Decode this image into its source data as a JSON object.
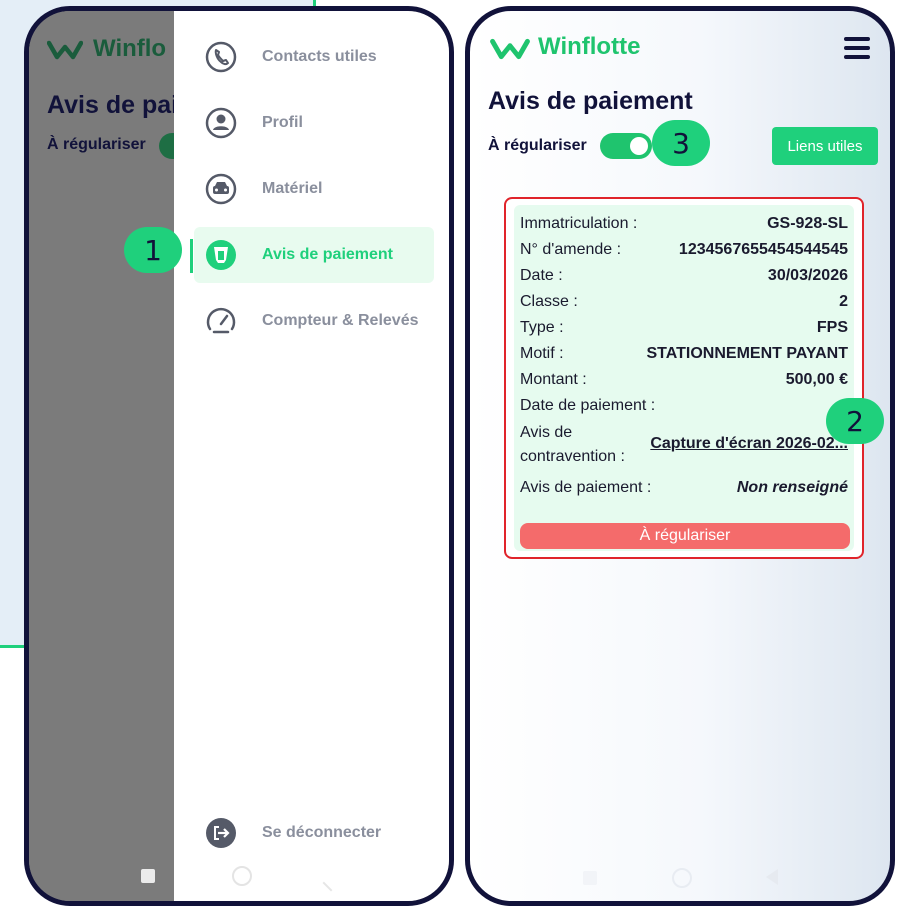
{
  "colors": {
    "brand_green": "#1fd07c",
    "dark_navy": "#11123a",
    "alert_red": "#e0242b",
    "status_button": "#f46b6b",
    "card_bg": "#e6fbef",
    "menu_gray": "#8a8f9d"
  },
  "brand": {
    "name": "Winflotte",
    "name_cropped": "Winflo"
  },
  "page": {
    "title": "Avis de paiement",
    "title_cropped": "Avis de pai",
    "toggle_label": "À régulariser",
    "toggle_on": true,
    "links_button": "Liens utiles"
  },
  "drawer": {
    "items": [
      {
        "label": "Contacts utiles",
        "icon": "phone-icon"
      },
      {
        "label": "Profil",
        "icon": "user-icon"
      },
      {
        "label": "Matériel",
        "icon": "car-icon"
      },
      {
        "label": "Avis de paiement",
        "icon": "cup-icon",
        "active": true
      },
      {
        "label": "Compteur & Relevés",
        "icon": "speedometer-icon"
      }
    ],
    "logout": {
      "label": "Se déconnecter",
      "icon": "logout-icon"
    }
  },
  "card": {
    "fields": [
      {
        "label": "Immatriculation :",
        "value": "GS-928-SL"
      },
      {
        "label": "N° d'amende :",
        "value": "1234567655454544545"
      },
      {
        "label": "Date :",
        "value": "30/03/2026"
      },
      {
        "label": "Classe :",
        "value": "2"
      },
      {
        "label": "Type :",
        "value": "FPS"
      },
      {
        "label": "Motif :",
        "value": "STATIONNEMENT PAYANT"
      },
      {
        "label": "Montant :",
        "value": "500,00 €"
      },
      {
        "label": "Date de paiement :",
        "value": ""
      }
    ],
    "contravention_label_1": "Avis de",
    "contravention_label_2": "contravention :",
    "contravention_value": "Capture d'écran 2026-02...",
    "payment_label": "Avis de paiement :",
    "payment_value": "Non renseigné",
    "status_button": "À régulariser"
  },
  "badges": {
    "one": "1",
    "two": "2",
    "three": "3"
  }
}
